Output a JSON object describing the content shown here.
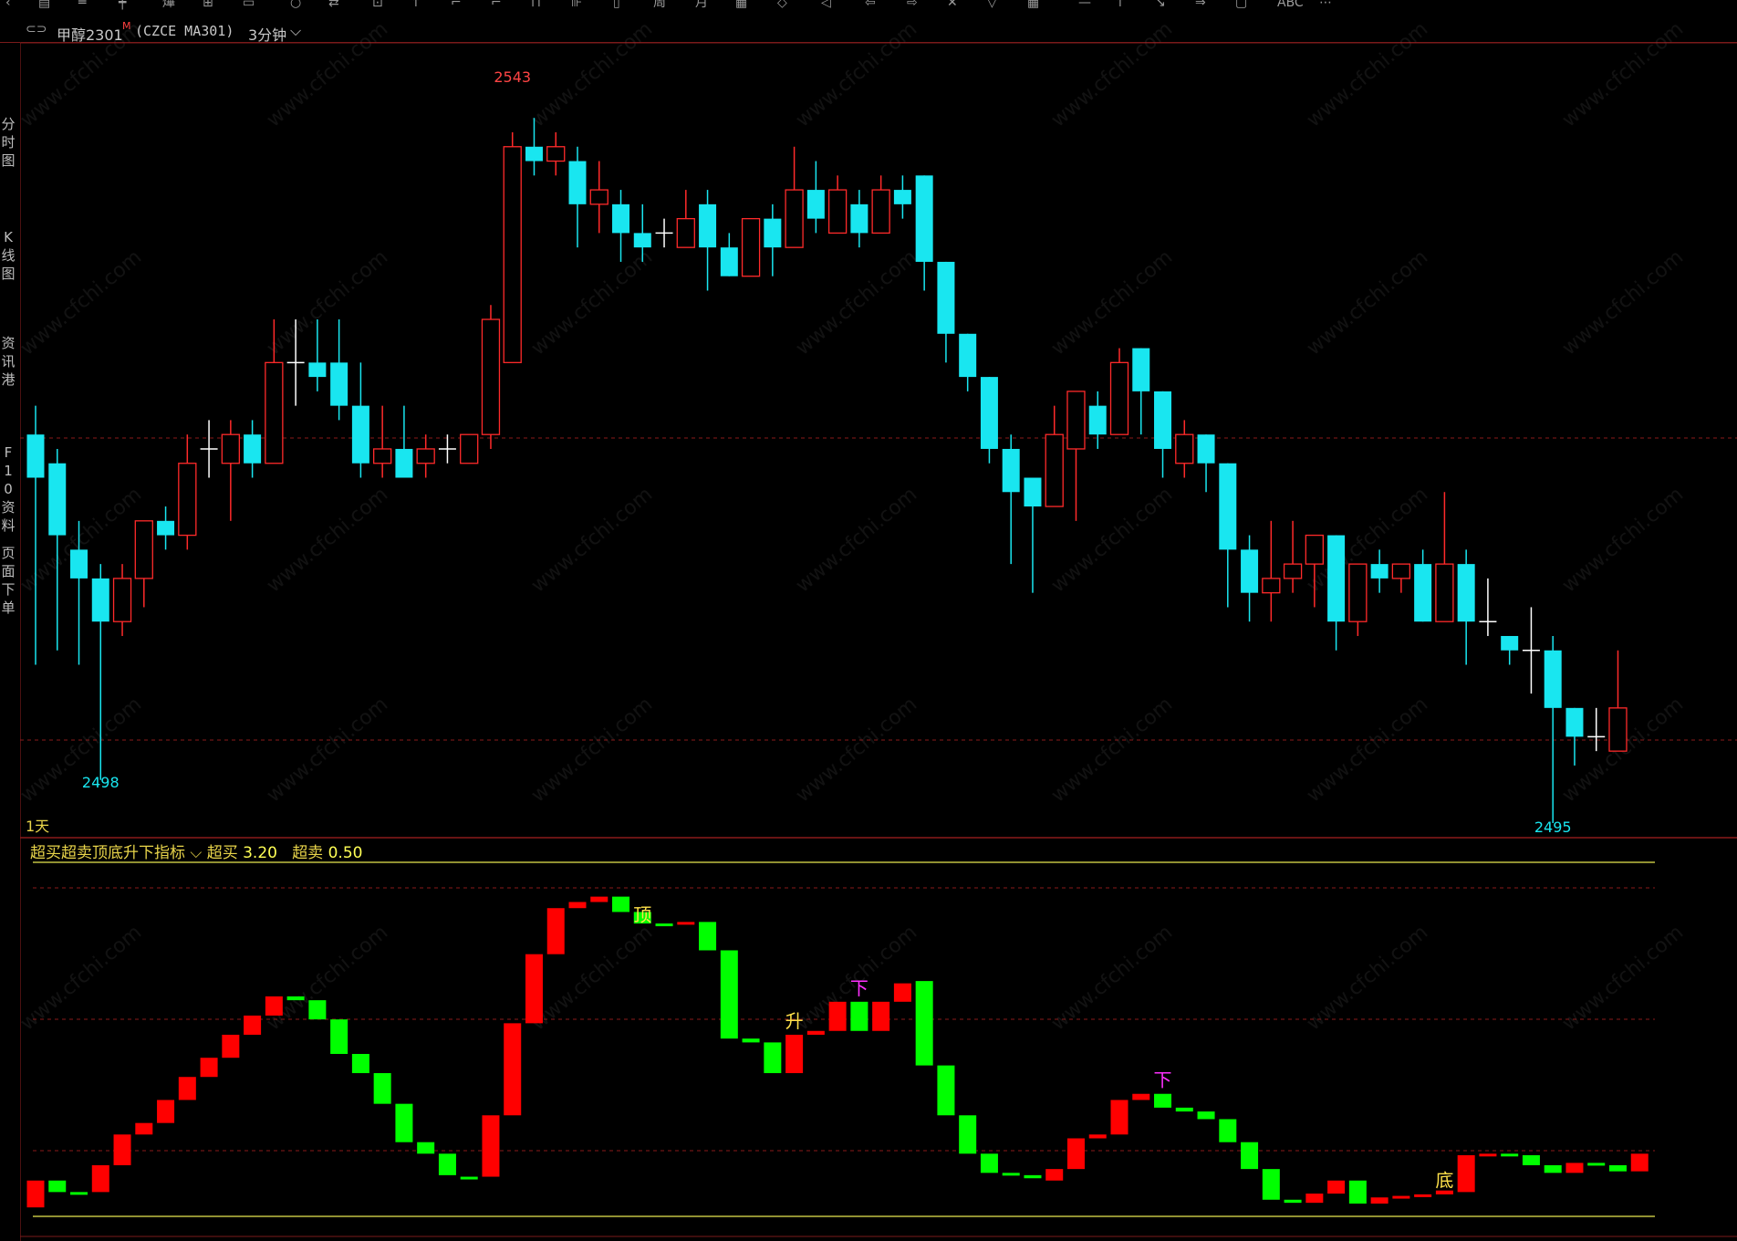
{
  "titlebar": {
    "symbol": "甲醇2301",
    "mark": "M",
    "code": "(CZCE MA301)",
    "period": "3分钟",
    "dropdown_icon": "chevron-down-icon",
    "link_icon": "link-icon"
  },
  "sidetabs": [
    "分时图",
    "K线图",
    "资讯港",
    "F10资料",
    "页面下单"
  ],
  "main": {
    "period_label": "1天",
    "high_label": "2543",
    "low_label": "2498",
    "low_label2": "2495"
  },
  "indicator": {
    "name": "超买超卖顶底升下指标",
    "overbought_label": "超买",
    "overbought_value": "3.20",
    "oversold_label": "超卖",
    "oversold_value": "0.50",
    "signals": [
      {
        "text": "顶",
        "bar": 28,
        "color": "#ffe14a"
      },
      {
        "text": "升",
        "bar": 35,
        "color": "#ffe14a"
      },
      {
        "text": "下",
        "bar": 38,
        "color": "#ff30ff"
      },
      {
        "text": "下",
        "bar": 52,
        "color": "#ff30ff"
      },
      {
        "text": "底",
        "bar": 65,
        "color": "#ffe14a"
      }
    ]
  },
  "watermark": "www.cfchi.com",
  "colors": {
    "up": "#ff2a2a",
    "down": "#19e6f0",
    "doji": "#ffffff",
    "ind_up": "#ff0000",
    "ind_down": "#00ff00",
    "level": "#e8e850"
  },
  "chart_data": {
    "type": "candlestick",
    "price_range": [
      2495,
      2543
    ],
    "candles": [
      {
        "o": 2522,
        "h": 2524,
        "l": 2506,
        "c": 2519
      },
      {
        "o": 2520,
        "h": 2521,
        "l": 2507,
        "c": 2515
      },
      {
        "o": 2514,
        "h": 2516,
        "l": 2506,
        "c": 2512
      },
      {
        "o": 2512,
        "h": 2513,
        "l": 2498,
        "c": 2509
      },
      {
        "o": 2509,
        "h": 2513,
        "l": 2508,
        "c": 2512
      },
      {
        "o": 2512,
        "h": 2516,
        "l": 2510,
        "c": 2516
      },
      {
        "o": 2516,
        "h": 2517,
        "l": 2514,
        "c": 2515
      },
      {
        "o": 2515,
        "h": 2522,
        "l": 2514,
        "c": 2520
      },
      {
        "o": 2521,
        "h": 2523,
        "l": 2519,
        "c": 2521
      },
      {
        "o": 2520,
        "h": 2523,
        "l": 2516,
        "c": 2522
      },
      {
        "o": 2522,
        "h": 2523,
        "l": 2519,
        "c": 2520
      },
      {
        "o": 2520,
        "h": 2530,
        "l": 2520,
        "c": 2527
      },
      {
        "o": 2527,
        "h": 2530,
        "l": 2524,
        "c": 2527
      },
      {
        "o": 2527,
        "h": 2530,
        "l": 2525,
        "c": 2526
      },
      {
        "o": 2527,
        "h": 2530,
        "l": 2523,
        "c": 2524
      },
      {
        "o": 2524,
        "h": 2527,
        "l": 2519,
        "c": 2520
      },
      {
        "o": 2520,
        "h": 2524,
        "l": 2519,
        "c": 2521
      },
      {
        "o": 2521,
        "h": 2524,
        "l": 2519,
        "c": 2519
      },
      {
        "o": 2520,
        "h": 2522,
        "l": 2519,
        "c": 2521
      },
      {
        "o": 2521,
        "h": 2522,
        "l": 2520,
        "c": 2521
      },
      {
        "o": 2520,
        "h": 2522,
        "l": 2520,
        "c": 2522
      },
      {
        "o": 2522,
        "h": 2531,
        "l": 2521,
        "c": 2530
      },
      {
        "o": 2527,
        "h": 2543,
        "l": 2527,
        "c": 2542
      },
      {
        "o": 2542,
        "h": 2544,
        "l": 2540,
        "c": 2541
      },
      {
        "o": 2541,
        "h": 2543,
        "l": 2540,
        "c": 2542
      },
      {
        "o": 2541,
        "h": 2542,
        "l": 2535,
        "c": 2538
      },
      {
        "o": 2538,
        "h": 2541,
        "l": 2536,
        "c": 2539
      },
      {
        "o": 2538,
        "h": 2539,
        "l": 2534,
        "c": 2536
      },
      {
        "o": 2536,
        "h": 2538,
        "l": 2534,
        "c": 2535
      },
      {
        "o": 2536,
        "h": 2537,
        "l": 2535,
        "c": 2536
      },
      {
        "o": 2535,
        "h": 2539,
        "l": 2535,
        "c": 2537
      },
      {
        "o": 2538,
        "h": 2539,
        "l": 2532,
        "c": 2535
      },
      {
        "o": 2535,
        "h": 2536,
        "l": 2533,
        "c": 2533
      },
      {
        "o": 2533,
        "h": 2537,
        "l": 2533,
        "c": 2537
      },
      {
        "o": 2537,
        "h": 2538,
        "l": 2533,
        "c": 2535
      },
      {
        "o": 2535,
        "h": 2542,
        "l": 2535,
        "c": 2539
      },
      {
        "o": 2539,
        "h": 2541,
        "l": 2536,
        "c": 2537
      },
      {
        "o": 2536,
        "h": 2540,
        "l": 2536,
        "c": 2539
      },
      {
        "o": 2538,
        "h": 2539,
        "l": 2535,
        "c": 2536
      },
      {
        "o": 2536,
        "h": 2540,
        "l": 2536,
        "c": 2539
      },
      {
        "o": 2539,
        "h": 2540,
        "l": 2537,
        "c": 2538
      },
      {
        "o": 2540,
        "h": 2540,
        "l": 2532,
        "c": 2534
      },
      {
        "o": 2534,
        "h": 2534,
        "l": 2527,
        "c": 2529
      },
      {
        "o": 2529,
        "h": 2529,
        "l": 2525,
        "c": 2526
      },
      {
        "o": 2526,
        "h": 2526,
        "l": 2520,
        "c": 2521
      },
      {
        "o": 2521,
        "h": 2522,
        "l": 2513,
        "c": 2518
      },
      {
        "o": 2519,
        "h": 2519,
        "l": 2511,
        "c": 2517
      },
      {
        "o": 2517,
        "h": 2524,
        "l": 2517,
        "c": 2522
      },
      {
        "o": 2521,
        "h": 2525,
        "l": 2516,
        "c": 2525
      },
      {
        "o": 2524,
        "h": 2525,
        "l": 2521,
        "c": 2522
      },
      {
        "o": 2522,
        "h": 2528,
        "l": 2522,
        "c": 2527
      },
      {
        "o": 2528,
        "h": 2528,
        "l": 2522,
        "c": 2525
      },
      {
        "o": 2525,
        "h": 2525,
        "l": 2519,
        "c": 2521
      },
      {
        "o": 2520,
        "h": 2523,
        "l": 2519,
        "c": 2522
      },
      {
        "o": 2522,
        "h": 2522,
        "l": 2518,
        "c": 2520
      },
      {
        "o": 2520,
        "h": 2520,
        "l": 2510,
        "c": 2514
      },
      {
        "o": 2514,
        "h": 2515,
        "l": 2509,
        "c": 2511
      },
      {
        "o": 2511,
        "h": 2516,
        "l": 2509,
        "c": 2512
      },
      {
        "o": 2512,
        "h": 2516,
        "l": 2511,
        "c": 2513
      },
      {
        "o": 2513,
        "h": 2515,
        "l": 2510,
        "c": 2515
      },
      {
        "o": 2515,
        "h": 2515,
        "l": 2507,
        "c": 2509
      },
      {
        "o": 2509,
        "h": 2513,
        "l": 2508,
        "c": 2513
      },
      {
        "o": 2513,
        "h": 2514,
        "l": 2511,
        "c": 2512
      },
      {
        "o": 2512,
        "h": 2513,
        "l": 2511,
        "c": 2513
      },
      {
        "o": 2513,
        "h": 2514,
        "l": 2509,
        "c": 2509
      },
      {
        "o": 2509,
        "h": 2518,
        "l": 2509,
        "c": 2513
      },
      {
        "o": 2513,
        "h": 2514,
        "l": 2506,
        "c": 2509
      },
      {
        "o": 2509,
        "h": 2512,
        "l": 2508,
        "c": 2509
      },
      {
        "o": 2508,
        "h": 2508,
        "l": 2506,
        "c": 2507
      },
      {
        "o": 2507,
        "h": 2510,
        "l": 2504,
        "c": 2507
      },
      {
        "o": 2507,
        "h": 2508,
        "l": 2495,
        "c": 2503
      },
      {
        "o": 2503,
        "h": 2503,
        "l": 2499,
        "c": 2501
      },
      {
        "o": 2501,
        "h": 2503,
        "l": 2500,
        "c": 2501
      },
      {
        "o": 2500,
        "h": 2507,
        "l": 2500,
        "c": 2503
      }
    ],
    "indicator_values": [
      {
        "o": 0.2,
        "c": 0.55
      },
      {
        "o": 0.55,
        "c": 0.4
      },
      {
        "o": 0.4,
        "c": 0.38
      },
      {
        "o": 0.4,
        "c": 0.75
      },
      {
        "o": 0.75,
        "c": 1.15
      },
      {
        "o": 1.15,
        "c": 1.3
      },
      {
        "o": 1.3,
        "c": 1.6
      },
      {
        "o": 1.6,
        "c": 1.9
      },
      {
        "o": 1.9,
        "c": 2.15
      },
      {
        "o": 2.15,
        "c": 2.45
      },
      {
        "o": 2.45,
        "c": 2.7
      },
      {
        "o": 2.7,
        "c": 2.95
      },
      {
        "o": 2.95,
        "c": 2.9
      },
      {
        "o": 2.9,
        "c": 2.65
      },
      {
        "o": 2.65,
        "c": 2.2
      },
      {
        "o": 2.2,
        "c": 1.95
      },
      {
        "o": 1.95,
        "c": 1.55
      },
      {
        "o": 1.55,
        "c": 1.05
      },
      {
        "o": 1.05,
        "c": 0.9
      },
      {
        "o": 0.9,
        "c": 0.62
      },
      {
        "o": 0.6,
        "c": 0.58
      },
      {
        "o": 0.6,
        "c": 1.4
      },
      {
        "o": 1.4,
        "c": 2.6
      },
      {
        "o": 2.6,
        "c": 3.5
      },
      {
        "o": 3.5,
        "c": 4.1
      },
      {
        "o": 4.1,
        "c": 4.18
      },
      {
        "o": 4.18,
        "c": 4.25
      },
      {
        "o": 4.25,
        "c": 4.05
      },
      {
        "o": 4.05,
        "c": 3.9
      },
      {
        "o": 3.9,
        "c": 3.88
      },
      {
        "o": 3.9,
        "c": 3.92
      },
      {
        "o": 3.92,
        "c": 3.55
      },
      {
        "o": 3.55,
        "c": 2.4
      },
      {
        "o": 2.4,
        "c": 2.35
      },
      {
        "o": 2.35,
        "c": 1.95
      },
      {
        "o": 1.95,
        "c": 2.45
      },
      {
        "o": 2.45,
        "c": 2.5
      },
      {
        "o": 2.5,
        "c": 2.88
      },
      {
        "o": 2.88,
        "c": 2.5
      },
      {
        "o": 2.5,
        "c": 2.88
      },
      {
        "o": 2.88,
        "c": 3.12
      },
      {
        "o": 3.15,
        "c": 2.05
      },
      {
        "o": 2.05,
        "c": 1.4
      },
      {
        "o": 1.4,
        "c": 0.9
      },
      {
        "o": 0.9,
        "c": 0.65
      },
      {
        "o": 0.65,
        "c": 0.62
      },
      {
        "o": 0.62,
        "c": 0.58
      },
      {
        "o": 0.55,
        "c": 0.7
      },
      {
        "o": 0.7,
        "c": 1.1
      },
      {
        "o": 1.1,
        "c": 1.15
      },
      {
        "o": 1.15,
        "c": 1.6
      },
      {
        "o": 1.6,
        "c": 1.68
      },
      {
        "o": 1.68,
        "c": 1.5
      },
      {
        "o": 1.5,
        "c": 1.45
      },
      {
        "o": 1.45,
        "c": 1.35
      },
      {
        "o": 1.35,
        "c": 1.05
      },
      {
        "o": 1.05,
        "c": 0.7
      },
      {
        "o": 0.7,
        "c": 0.3
      },
      {
        "o": 0.3,
        "c": 0.26
      },
      {
        "o": 0.26,
        "c": 0.38
      },
      {
        "o": 0.38,
        "c": 0.55
      },
      {
        "o": 0.55,
        "c": 0.25
      },
      {
        "o": 0.25,
        "c": 0.33
      },
      {
        "o": 0.33,
        "c": 0.35
      },
      {
        "o": 0.35,
        "c": 0.37
      },
      {
        "o": 0.37,
        "c": 0.42
      },
      {
        "o": 0.4,
        "c": 0.88
      },
      {
        "o": 0.88,
        "c": 0.9
      },
      {
        "o": 0.9,
        "c": 0.88
      },
      {
        "o": 0.88,
        "c": 0.75
      },
      {
        "o": 0.75,
        "c": 0.65
      },
      {
        "o": 0.65,
        "c": 0.78
      },
      {
        "o": 0.78,
        "c": 0.75
      },
      {
        "o": 0.75,
        "c": 0.67
      },
      {
        "o": 0.67,
        "c": 0.9
      }
    ],
    "indicator_range": [
      0,
      4.4
    ]
  }
}
